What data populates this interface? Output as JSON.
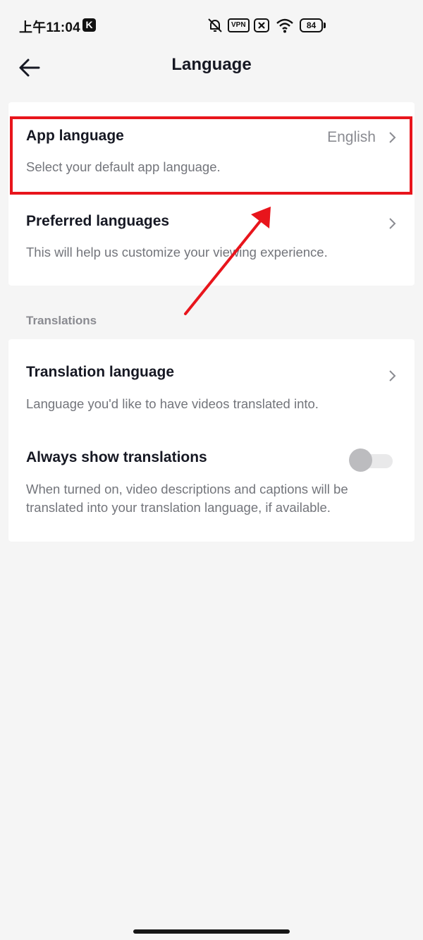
{
  "status_bar": {
    "time": "上午11:04",
    "app_badge": "K",
    "vpn": "VPN",
    "battery": "84",
    "icons": [
      "bell-off-icon",
      "vpn-icon",
      "no-sim-icon",
      "wifi-icon",
      "battery-icon"
    ]
  },
  "header": {
    "title": "Language",
    "back_icon": "back-arrow-icon"
  },
  "language_section": {
    "items": [
      {
        "title": "App language",
        "subtitle": "Select your default app language.",
        "value": "English"
      },
      {
        "title": "Preferred languages",
        "subtitle": "This will help us customize your viewing experience."
      }
    ]
  },
  "translations_section": {
    "label": "Translations",
    "items": [
      {
        "title": "Translation language",
        "subtitle": "Language you'd like to have videos translated into."
      },
      {
        "title": "Always show translations",
        "subtitle": "When turned on, video descriptions and captions will be translated into your translation language, if available.",
        "toggle_on": false
      }
    ]
  },
  "colors": {
    "annotation": "#e8151c",
    "background": "#f5f5f5",
    "card": "#ffffff",
    "primary_text": "#161823",
    "secondary_text": "#73757b"
  }
}
